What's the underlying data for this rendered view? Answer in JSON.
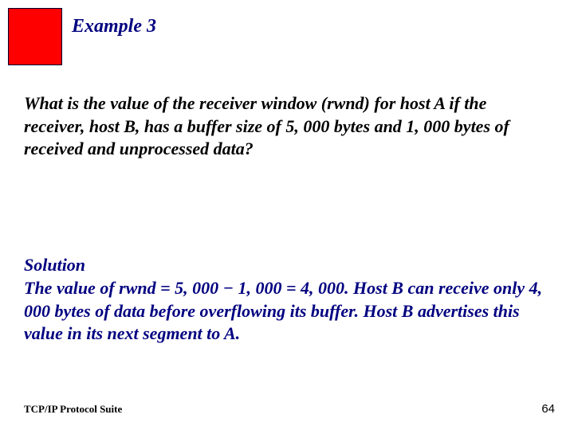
{
  "header": {
    "title": "Example 3"
  },
  "content": {
    "question": "What is the value of the receiver window (rwnd) for host A if the receiver, host B, has a buffer size of 5, 000 bytes and 1, 000 bytes of received and unprocessed data?",
    "solution_label": "Solution",
    "solution_text": "The value of rwnd = 5, 000 − 1, 000 = 4, 000. Host B can receive only 4, 000 bytes of data before overflowing its buffer. Host B advertises this value in its next segment to A."
  },
  "footer": {
    "left": "TCP/IP Protocol Suite",
    "right": "64"
  }
}
